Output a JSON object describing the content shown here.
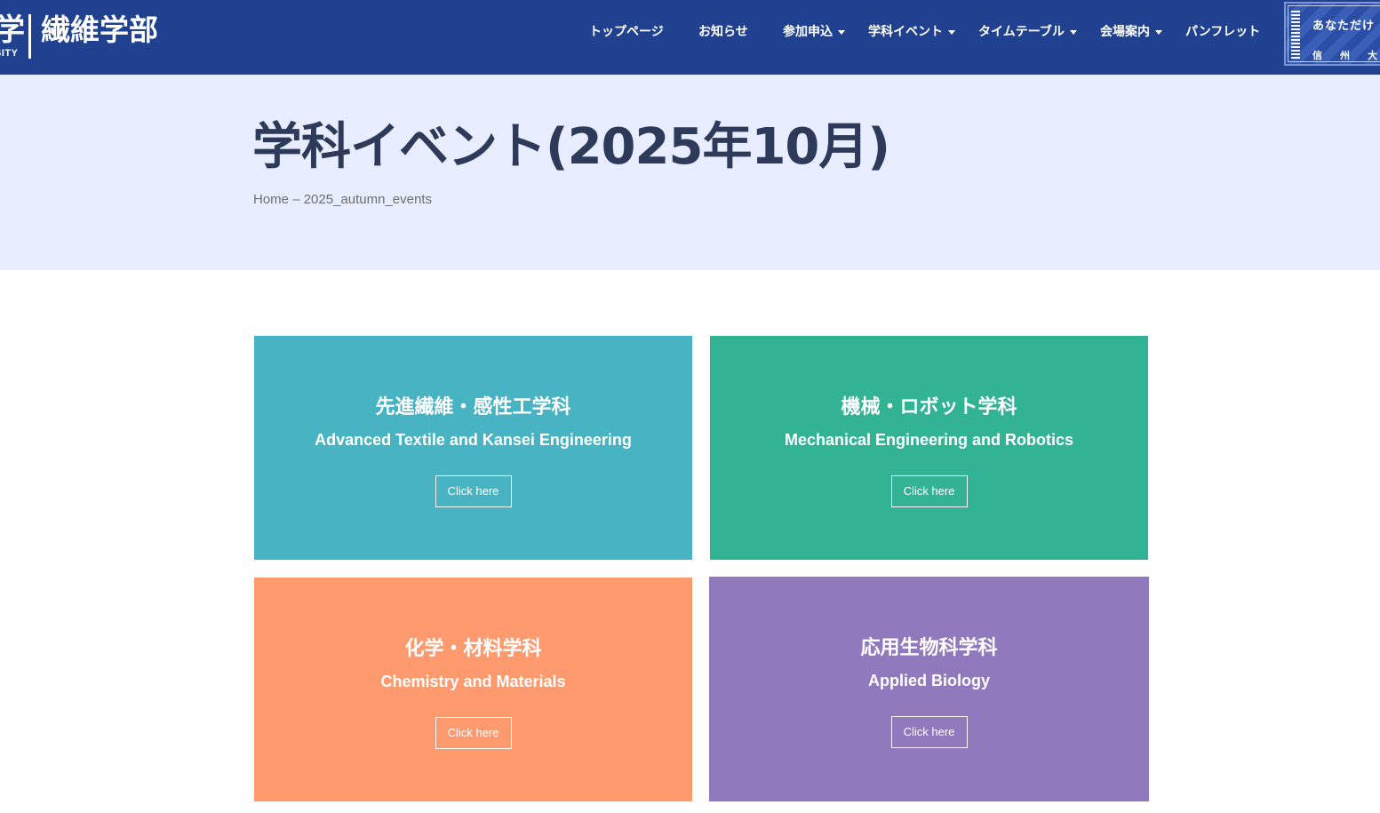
{
  "header": {
    "logo": {
      "main": "学",
      "sub": "SITY",
      "dept": "繊維学部"
    },
    "nav": [
      {
        "label": "トップページ",
        "dropdown": false
      },
      {
        "label": "お知らせ",
        "dropdown": false
      },
      {
        "label": "参加申込",
        "dropdown": true
      },
      {
        "label": "学科イベント",
        "dropdown": true
      },
      {
        "label": "タイムテーブル",
        "dropdown": true
      },
      {
        "label": "会場案内",
        "dropdown": true
      },
      {
        "label": "パンフレット",
        "dropdown": false
      }
    ],
    "banner": {
      "top": "あなただけ",
      "bottom": "信州大"
    },
    "colors": {
      "background": "#20418f"
    }
  },
  "page": {
    "title": "学科イベント(2025年10月)",
    "breadcrumb": {
      "home": "Home",
      "separator": "–",
      "current": "2025_autumn_events"
    }
  },
  "cards": [
    {
      "jp": "先進繊維・感性工学科",
      "en": "Advanced Textile and Kansei Engineering",
      "button": "Click here",
      "color": "#47b3c3"
    },
    {
      "jp": "機械・ロボット学科",
      "en": "Mechanical Engineering and Robotics",
      "button": "Click here",
      "color": "#31b394"
    },
    {
      "jp": "化学・材料学科",
      "en": "Chemistry and Materials",
      "button": "Click here",
      "color": "#ff9a6e"
    },
    {
      "jp": "応用生物科学科",
      "en": "Applied Biology",
      "button": "Click here",
      "color": "#9079bc"
    }
  ]
}
